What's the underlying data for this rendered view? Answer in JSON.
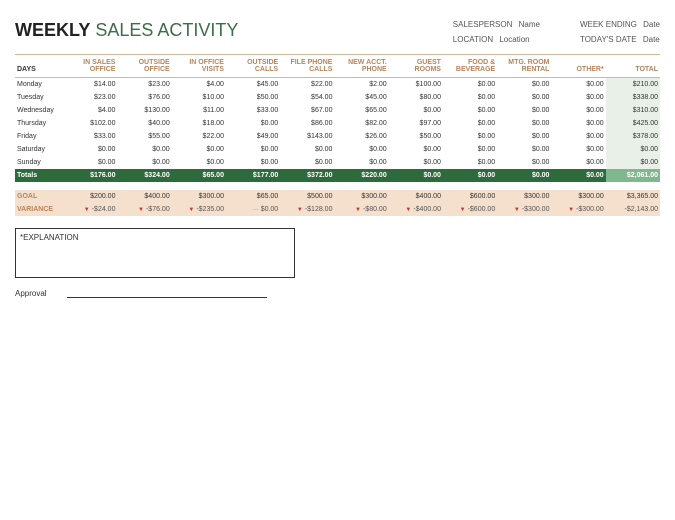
{
  "title": {
    "bold": "WEEKLY",
    "light": "SALES ACTIVITY"
  },
  "meta": {
    "salesperson_label": "SALESPERSON",
    "salesperson_value": "Name",
    "location_label": "LOCATION",
    "location_value": "Location",
    "weekending_label": "WEEK ENDING",
    "weekending_value": "Date",
    "today_label": "TODAY'S DATE",
    "today_value": "Date"
  },
  "headers": [
    "DAYS",
    "IN SALES OFFICE",
    "OUTSIDE OFFICE",
    "IN OFFICE VISITS",
    "OUTSIDE CALLS",
    "FILE PHONE CALLS",
    "NEW ACCT. PHONE",
    "GUEST ROOMS",
    "FOOD & BEVERAGE",
    "MTG. ROOM RENTAL",
    "OTHER*",
    "TOTAL"
  ],
  "rows": [
    {
      "day": "Monday",
      "v": [
        "$14.00",
        "$23.00",
        "$4.00",
        "$45.00",
        "$22.00",
        "$2.00",
        "$100.00",
        "$0.00",
        "$0.00",
        "$0.00",
        "$210.00"
      ]
    },
    {
      "day": "Tuesday",
      "v": [
        "$23.00",
        "$76.00",
        "$10.00",
        "$50.00",
        "$54.00",
        "$45.00",
        "$80.00",
        "$0.00",
        "$0.00",
        "$0.00",
        "$338.00"
      ]
    },
    {
      "day": "Wednesday",
      "v": [
        "$4.00",
        "$130.00",
        "$11.00",
        "$33.00",
        "$67.00",
        "$65.00",
        "$0.00",
        "$0.00",
        "$0.00",
        "$0.00",
        "$310.00"
      ]
    },
    {
      "day": "Thursday",
      "v": [
        "$102.00",
        "$40.00",
        "$18.00",
        "$0.00",
        "$86.00",
        "$82.00",
        "$97.00",
        "$0.00",
        "$0.00",
        "$0.00",
        "$425.00"
      ]
    },
    {
      "day": "Friday",
      "v": [
        "$33.00",
        "$55.00",
        "$22.00",
        "$49.00",
        "$143.00",
        "$26.00",
        "$50.00",
        "$0.00",
        "$0.00",
        "$0.00",
        "$378.00"
      ]
    },
    {
      "day": "Saturday",
      "v": [
        "$0.00",
        "$0.00",
        "$0.00",
        "$0.00",
        "$0.00",
        "$0.00",
        "$0.00",
        "$0.00",
        "$0.00",
        "$0.00",
        "$0.00"
      ]
    },
    {
      "day": "Sunday",
      "v": [
        "$0.00",
        "$0.00",
        "$0.00",
        "$0.00",
        "$0.00",
        "$0.00",
        "$0.00",
        "$0.00",
        "$0.00",
        "$0.00",
        "$0.00"
      ]
    }
  ],
  "totals": {
    "label": "Totals",
    "v": [
      "$176.00",
      "$324.00",
      "$65.00",
      "$177.00",
      "$372.00",
      "$220.00",
      "$0.00",
      "$0.00",
      "$0.00",
      "$0.00",
      "$2,061.00"
    ]
  },
  "goal": {
    "label": "GOAL",
    "v": [
      "$200.00",
      "$400.00",
      "$300.00",
      "$65.00",
      "$500.00",
      "$300.00",
      "$400.00",
      "$600.00",
      "$300.00",
      "$300.00",
      "$3,365.00"
    ]
  },
  "variance": {
    "label": "VARIANCE",
    "v": [
      "-$24.00",
      "-$76.00",
      "-$235.00",
      "$0.00",
      "-$128.00",
      "-$80.00",
      "-$400.00",
      "-$600.00",
      "-$300.00",
      "-$300.00",
      "-$2,143.00"
    ],
    "flags": [
      "neg",
      "neg",
      "neg",
      "zero",
      "neg",
      "neg",
      "neg",
      "neg",
      "neg",
      "neg",
      ""
    ]
  },
  "explanation_label": "*EXPLANATION",
  "approval_label": "Approval"
}
